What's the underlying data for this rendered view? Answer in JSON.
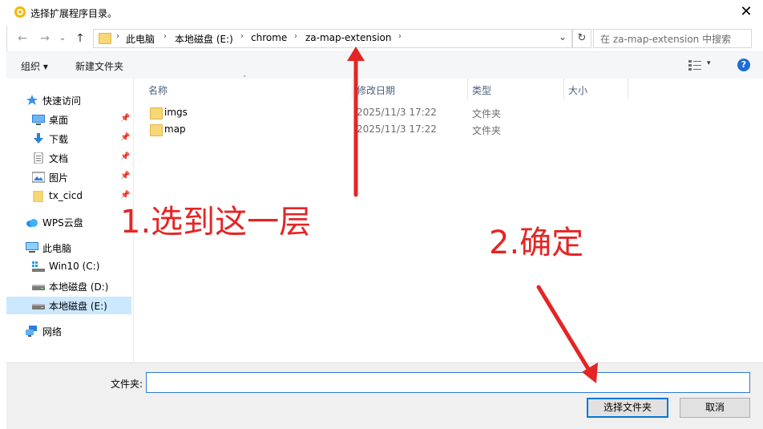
{
  "window": {
    "title": "选择扩展程序目录。",
    "close_glyph": "✕"
  },
  "nav": {
    "back_glyph": "←",
    "forward_glyph": "→",
    "dropdown_glyph": "⌄",
    "up_glyph": "↑",
    "breadcrumb": [
      "此电脑",
      "本地磁盘 (E:)",
      "chrome",
      "za-map-extension"
    ],
    "separator": "›",
    "addr_dropdown_glyph": "⌄",
    "refresh_glyph": "↻",
    "search_placeholder": "在 za-map-extension 中搜索"
  },
  "toolbar": {
    "organize_label": "组织 ▾",
    "new_folder_label": "新建文件夹",
    "view_dropdown_glyph": "▾",
    "help_glyph": "?"
  },
  "sidebar": {
    "items": [
      {
        "label": "快速访问",
        "icon": "star-icon"
      },
      {
        "label": "桌面",
        "icon": "desktop-icon",
        "pinned": true
      },
      {
        "label": "下载",
        "icon": "download-icon",
        "pinned": true
      },
      {
        "label": "文档",
        "icon": "document-icon",
        "pinned": true
      },
      {
        "label": "图片",
        "icon": "pictures-icon",
        "pinned": true
      },
      {
        "label": "tx_cicd",
        "icon": "folder-icon",
        "pinned": true
      },
      {
        "label": "WPS云盘",
        "icon": "cloud-icon"
      },
      {
        "label": "此电脑",
        "icon": "computer-icon"
      },
      {
        "label": "Win10 (C:)",
        "icon": "windows-drive-icon"
      },
      {
        "label": "本地磁盘 (D:)",
        "icon": "drive-icon"
      },
      {
        "label": "本地磁盘 (E:)",
        "icon": "drive-icon",
        "selected": true
      },
      {
        "label": "网络",
        "icon": "network-icon"
      }
    ],
    "pin_glyph": "📌"
  },
  "file_list": {
    "columns": [
      "名称",
      "修改日期",
      "类型",
      "大小"
    ],
    "sort_caret": "˄",
    "rows": [
      {
        "name": "imgs",
        "modified": "2025/11/3 17:22",
        "type": "文件夹",
        "size": ""
      },
      {
        "name": "map",
        "modified": "2025/11/3 17:22",
        "type": "文件夹",
        "size": ""
      }
    ]
  },
  "footer": {
    "folder_label": "文件夹:",
    "folder_value": "",
    "select_button": "选择文件夹",
    "cancel_button": "取消"
  },
  "annotations": {
    "step1": "1.选到这一层",
    "step2": "2.确定",
    "color": "#e42525"
  },
  "colors": {
    "selection": "#cce8ff",
    "accent": "#0078d7",
    "folder": "#f8d775"
  }
}
